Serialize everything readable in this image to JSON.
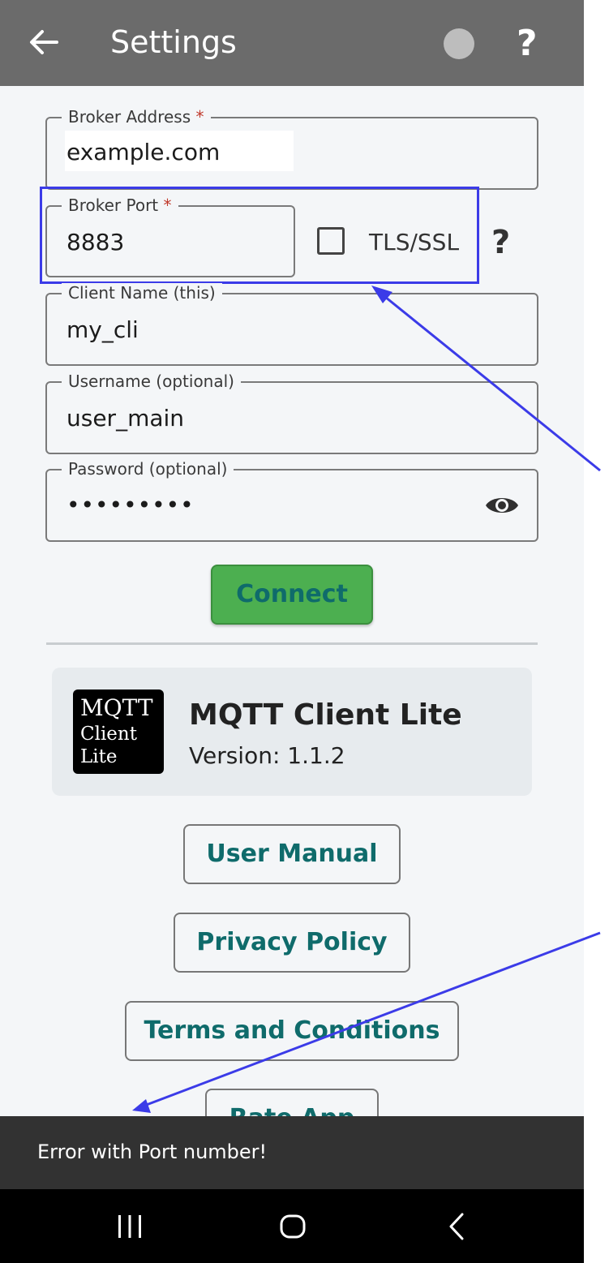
{
  "appbar": {
    "title": "Settings",
    "back_icon": "arrow-left-icon",
    "status_icon": "status-dot-icon",
    "help_text": "?"
  },
  "form": {
    "broker_address": {
      "label": "Broker Address",
      "required_mark": "*",
      "value": "example.com"
    },
    "broker_port": {
      "label": "Broker Port",
      "required_mark": "*",
      "value": "8883"
    },
    "tls": {
      "label": "TLS/SSL",
      "checked": false,
      "help_text": "?"
    },
    "client_name": {
      "label": "Client Name (this)",
      "value": "my_cli"
    },
    "username": {
      "label": "Username (optional)",
      "value": "user_main"
    },
    "password": {
      "label": "Password (optional)",
      "value": "•••••••••",
      "eye_icon": "eye-icon"
    },
    "connect_label": "Connect"
  },
  "about": {
    "logo_lines": [
      "MQTT",
      "Client",
      "Lite"
    ],
    "app_name": "MQTT Client Lite",
    "version": "Version: 1.1.2"
  },
  "links": {
    "user_manual": "User Manual",
    "privacy_policy": "Privacy Policy",
    "terms": "Terms and Conditions",
    "rate_app": "Rate App"
  },
  "snackbar": {
    "message": "Error with Port number!"
  },
  "colors": {
    "appbar": "#6b6b6b",
    "accent_teal": "#0f6b6b",
    "connect_green": "#4caf50",
    "highlight_blue": "#3b3be8",
    "snackbar": "#323232"
  }
}
